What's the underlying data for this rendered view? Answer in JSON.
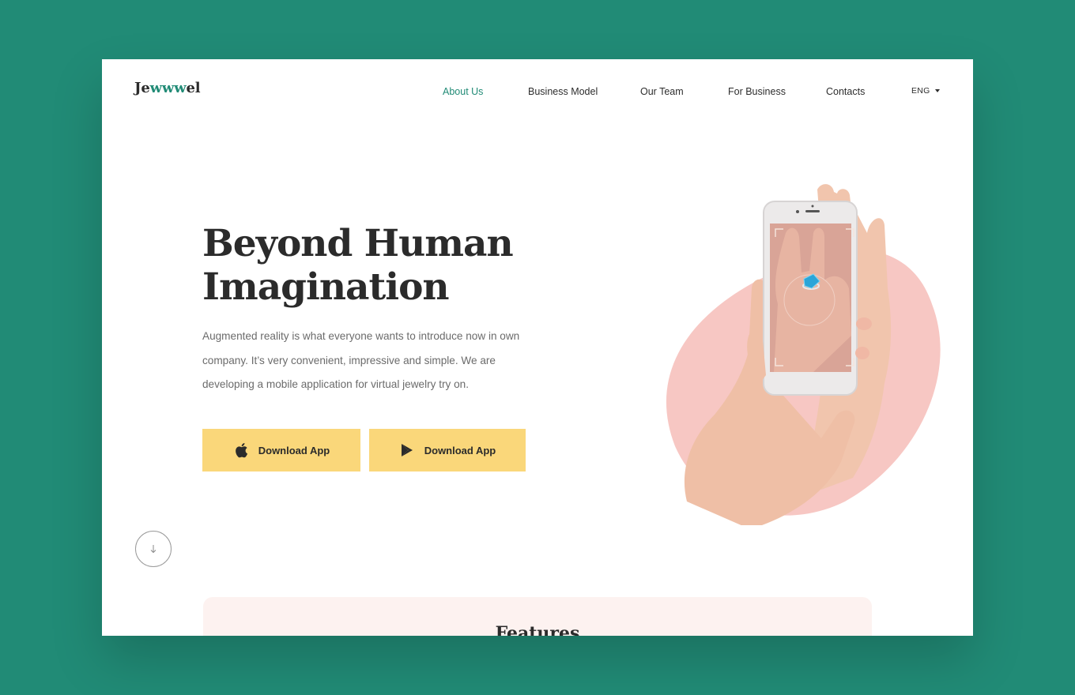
{
  "header": {
    "logo_prefix": "Je",
    "logo_accent": "www",
    "logo_suffix": "el",
    "nav": [
      {
        "label": "About Us",
        "active": true
      },
      {
        "label": "Business Model",
        "active": false
      },
      {
        "label": "Our Team",
        "active": false
      },
      {
        "label": "For Business",
        "active": false
      },
      {
        "label": "Contacts",
        "active": false
      }
    ],
    "language": "ENG"
  },
  "hero": {
    "title_line1": "Beyond Human",
    "title_line2": "Imagination",
    "description": "Augmented reality is what everyone wants to introduce now in own company. It’s very convenient, impressive and simple. We are developing a mobile application for virtual jewelry try on.",
    "buttons": [
      {
        "label": "Download App",
        "icon": "apple-icon"
      },
      {
        "label": "Download App",
        "icon": "google-play-icon"
      }
    ],
    "scroll_icon": "arrow-down-icon",
    "image": "hands-phone-ring-ar-image"
  },
  "features": {
    "title": "Features"
  },
  "colors": {
    "background": "#218b76",
    "accent": "#218b76",
    "button": "#fad77a",
    "blob": "#f7c7c3",
    "text": "#2b2b2b"
  }
}
